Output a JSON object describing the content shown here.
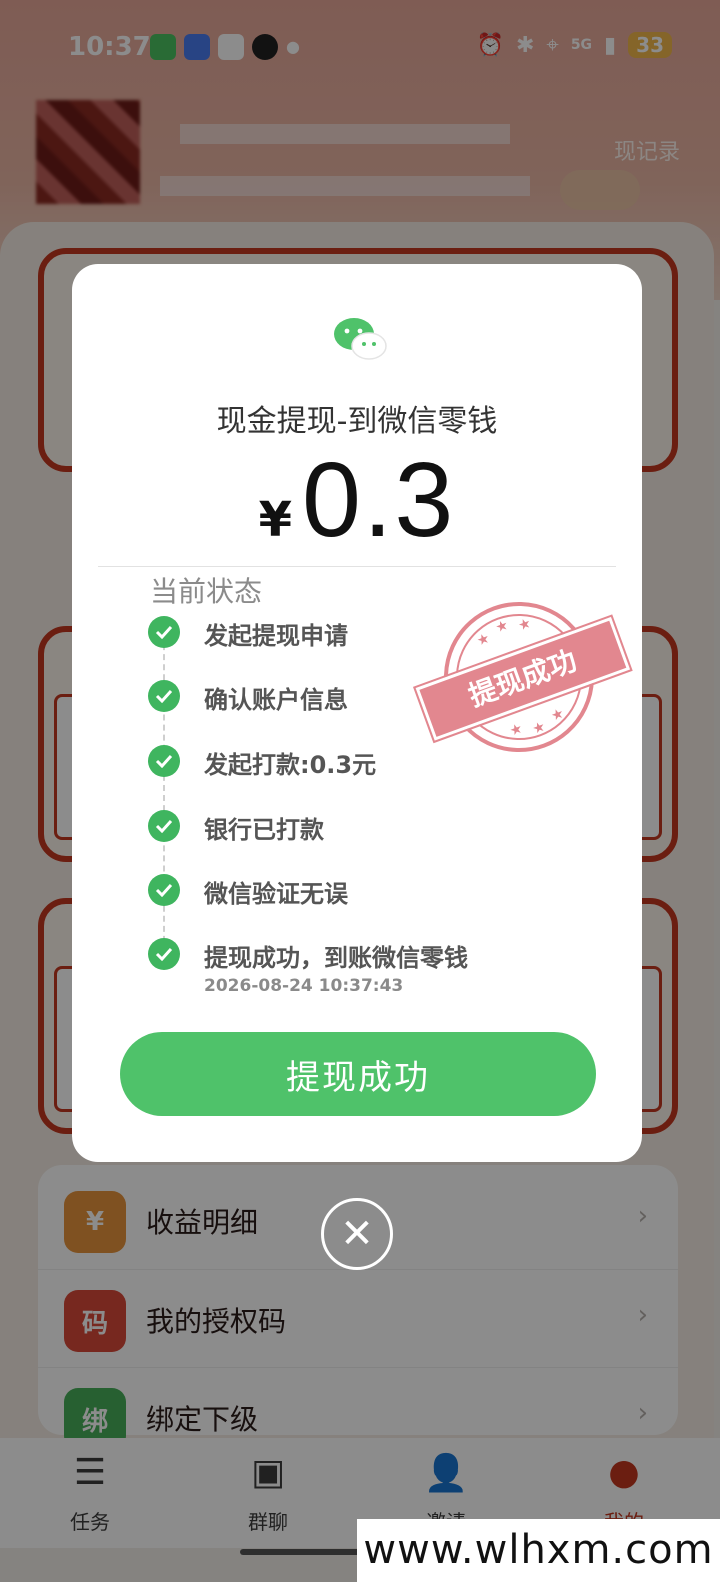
{
  "status_bar": {
    "time": "10:37",
    "network": "5G",
    "battery": "33"
  },
  "background": {
    "record_link": "现记录"
  },
  "menu": [
    {
      "icon_text": "¥",
      "label": "收益明细",
      "color": "#e8943c"
    },
    {
      "icon_text": "码",
      "label": "我的授权码",
      "color": "#d94a3a"
    },
    {
      "icon_text": "绑",
      "label": "绑定下级",
      "color": "#47b05a"
    }
  ],
  "tabs": [
    {
      "label": "任务",
      "icon": "task-icon"
    },
    {
      "label": "群聊",
      "icon": "chat-icon"
    },
    {
      "label": "邀请",
      "icon": "invite-icon"
    },
    {
      "label": "我的",
      "icon": "profile-icon",
      "active": true
    }
  ],
  "modal": {
    "title": "现金提现-到微信零钱",
    "currency": "¥",
    "amount": "0.3",
    "status_heading": "当前状态",
    "steps": [
      {
        "label": "发起提现申请"
      },
      {
        "label": "确认账户信息"
      },
      {
        "label": "发起打款:0.3元"
      },
      {
        "label": "银行已打款"
      },
      {
        "label": "微信验证无误"
      },
      {
        "label": "提现成功，到账微信零钱",
        "time": "2026-08-24 10:37:43"
      }
    ],
    "stamp_text": "提现成功",
    "button_label": "提现成功",
    "check_color": "#3fb55f",
    "button_color": "#4fc26a"
  },
  "watermark": "www.wlhxm.com"
}
